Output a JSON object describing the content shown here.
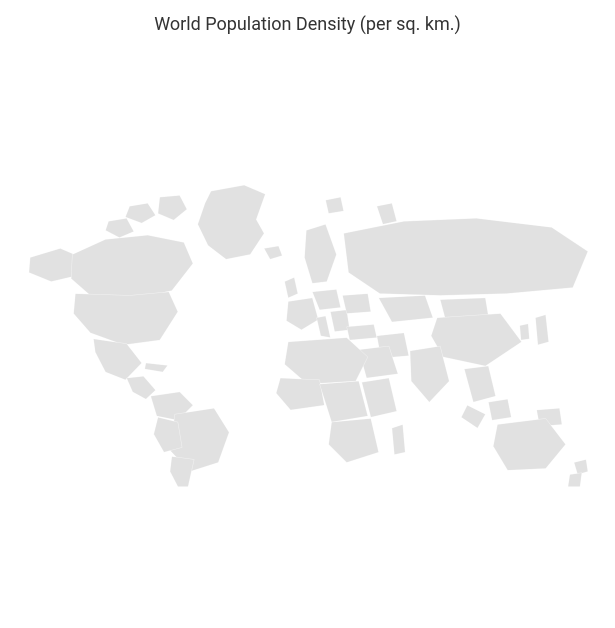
{
  "title": "World Population Density (per sq. km.)",
  "chart_data": {
    "type": "map",
    "title": "World Population Density (per sq. km.)",
    "projection": "equirectangular",
    "fill_color": "#e1e1e1",
    "stroke_color": "#ffffff",
    "series": [],
    "note": "No data values are rendered on the map; all countries are displayed with a single uniform fill color."
  }
}
